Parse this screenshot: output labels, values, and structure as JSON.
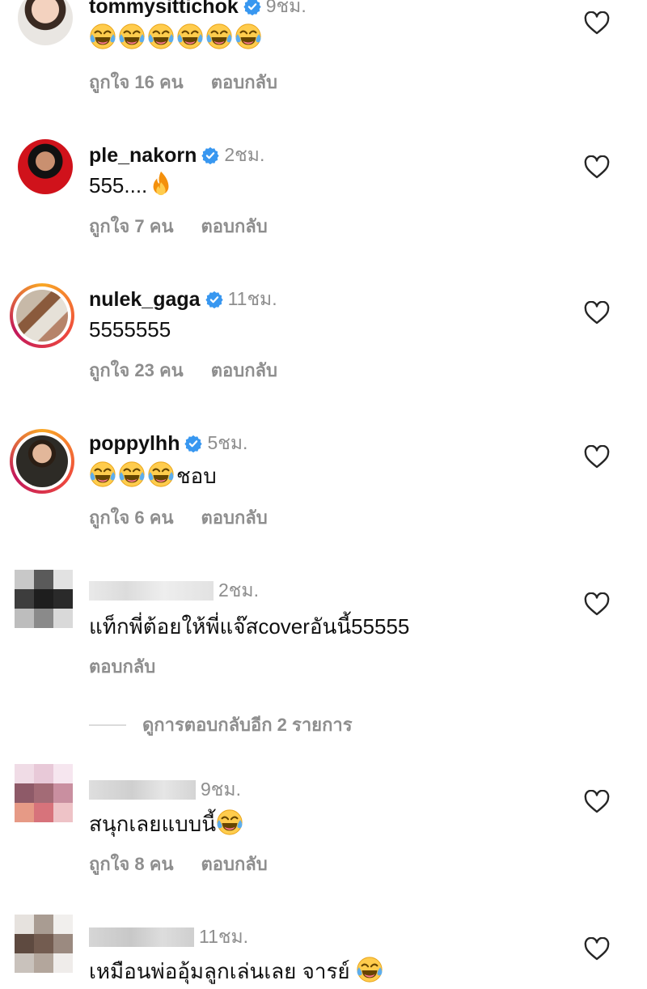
{
  "comments": [
    {
      "username": "tommysittichok",
      "time": "9ชม.",
      "text": "",
      "emojis": 6,
      "likes": "ถูกใจ 16 คน",
      "reply": "ตอบกลับ"
    },
    {
      "username": "ple_nakorn",
      "time": "2ชม.",
      "text": "555....",
      "likes": "ถูกใจ 7 คน",
      "reply": "ตอบกลับ"
    },
    {
      "username": "nulek_gaga",
      "time": "11ชม.",
      "text": "5555555",
      "likes": "ถูกใจ 23 คน",
      "reply": "ตอบกลับ"
    },
    {
      "username": "poppylhh",
      "time": "5ชม.",
      "text": "ชอบ",
      "emojis": 3,
      "likes": "ถูกใจ 6 คน",
      "reply": "ตอบกลับ"
    },
    {
      "username": "",
      "time": "2ชม.",
      "text": "แท็กพี่ต้อยให้พี่แจ๊สcoverอันนี้55555",
      "reply": "ตอบกลับ"
    },
    {
      "username": "",
      "time": "9ชม.",
      "text": "สนุกเลยแบบนี้",
      "likes": "ถูกใจ 8 คน",
      "reply": "ตอบกลับ"
    },
    {
      "username": "",
      "time": "11ชม.",
      "text": "เหมือนพ่ออุ้มลูกเล่นเลย จารย์ "
    }
  ],
  "view_more_replies": "ดูการตอบกลับอีก 2 รายการ",
  "colors": {
    "verified": "#3897f0",
    "muted": "#8e8e8e",
    "text": "#111111"
  },
  "icons": [
    "verified-badge-icon",
    "heart-icon",
    "laughing-emoji-icon",
    "fire-emoji-icon"
  ]
}
